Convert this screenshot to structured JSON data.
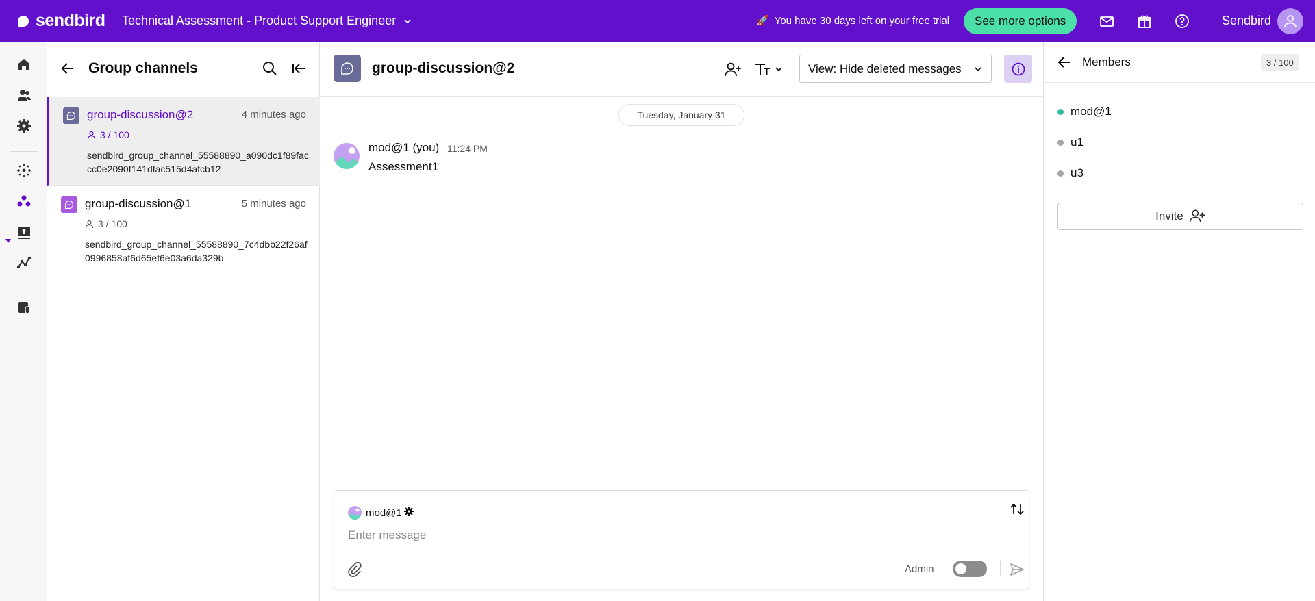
{
  "topbar": {
    "logo_text": "sendbird",
    "org_name": "Technical Assessment - Product Support Engineer",
    "trial_text": "You have 30 days left on your free trial",
    "see_more_label": "See more options",
    "user_name": "Sendbird"
  },
  "rail": {
    "items": [
      "home-icon",
      "users-icon",
      "settings-icon",
      "network-icon",
      "chat-group-icon",
      "upload-icon",
      "analytics-icon",
      "docs-icon"
    ]
  },
  "channel_list": {
    "title": "Group channels",
    "channels": [
      {
        "name": "group-discussion@2",
        "time": "4 minutes ago",
        "members": "3 / 100",
        "url": "sendbird_group_channel_55588890_a090dc1f89faccc0e2090f141dfac515d4afcb12"
      },
      {
        "name": "group-discussion@1",
        "time": "5 minutes ago",
        "members": "3 / 100",
        "url": "sendbird_group_channel_55588890_7c4dbb22f26af0996858af6d65ef6e03a6da329b"
      }
    ]
  },
  "chat": {
    "title": "group-discussion@2",
    "view_label": "View:",
    "view_value": "Hide deleted messages",
    "date": "Tuesday, January 31",
    "message": {
      "sender": "mod@1 (you)",
      "time": "11:24 PM",
      "text": "Assessment1"
    },
    "composer": {
      "sender": "mod@1",
      "placeholder": "Enter message",
      "admin_label": "Admin"
    }
  },
  "members_panel": {
    "title": "Members",
    "count": "3 / 100",
    "members": [
      {
        "name": "mod@1",
        "status": "online"
      },
      {
        "name": "u1",
        "status": "offline"
      },
      {
        "name": "u3",
        "status": "offline"
      }
    ],
    "invite_label": "Invite"
  },
  "colors": {
    "brand": "#6210cc",
    "accent_green": "#4ae0a8",
    "online": "#2eba9f"
  }
}
